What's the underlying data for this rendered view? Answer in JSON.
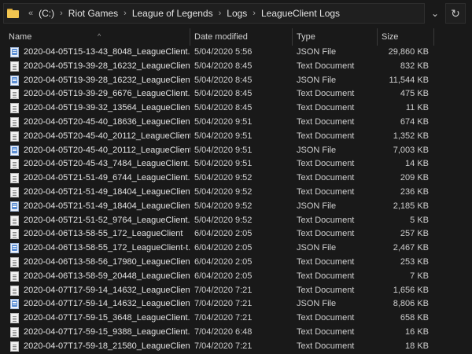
{
  "address": {
    "overflow": "«",
    "crumbs": [
      "(C:)",
      "Riot Games",
      "League of Legends",
      "Logs",
      "LeagueClient Logs"
    ],
    "separator": "›",
    "dropdown_glyph": "⌄",
    "refresh_glyph": "↻"
  },
  "columns": {
    "name": "Name",
    "date": "Date modified",
    "type": "Type",
    "size": "Size",
    "sort_glyph": "^"
  },
  "icons": {
    "folder": "folder-icon",
    "text": "text-document-icon",
    "json": "json-file-icon"
  },
  "files": [
    {
      "name": "2020-04-05T15-13-43_8048_LeagueClient...",
      "date": "5/04/2020 5:56",
      "type": "JSON File",
      "size": "29,860 KB",
      "icon": "json"
    },
    {
      "name": "2020-04-05T19-39-28_16232_LeagueClient",
      "date": "5/04/2020 8:45",
      "type": "Text Document",
      "size": "832 KB",
      "icon": "txt"
    },
    {
      "name": "2020-04-05T19-39-28_16232_LeagueClient",
      "date": "5/04/2020 8:45",
      "type": "JSON File",
      "size": "11,544 KB",
      "icon": "json"
    },
    {
      "name": "2020-04-05T19-39-29_6676_LeagueClient...",
      "date": "5/04/2020 8:45",
      "type": "Text Document",
      "size": "475 KB",
      "icon": "txt"
    },
    {
      "name": "2020-04-05T19-39-32_13564_LeagueClien...",
      "date": "5/04/2020 8:45",
      "type": "Text Document",
      "size": "11 KB",
      "icon": "txt"
    },
    {
      "name": "2020-04-05T20-45-40_18636_LeagueClien...",
      "date": "5/04/2020 9:51",
      "type": "Text Document",
      "size": "674 KB",
      "icon": "txt"
    },
    {
      "name": "2020-04-05T20-45-40_20112_LeagueClient",
      "date": "5/04/2020 9:51",
      "type": "Text Document",
      "size": "1,352 KB",
      "icon": "txt"
    },
    {
      "name": "2020-04-05T20-45-40_20112_LeagueClient",
      "date": "5/04/2020 9:51",
      "type": "JSON File",
      "size": "7,003 KB",
      "icon": "json"
    },
    {
      "name": "2020-04-05T20-45-43_7484_LeagueClient...",
      "date": "5/04/2020 9:51",
      "type": "Text Document",
      "size": "14 KB",
      "icon": "txt"
    },
    {
      "name": "2020-04-05T21-51-49_6744_LeagueClient...",
      "date": "5/04/2020 9:52",
      "type": "Text Document",
      "size": "209 KB",
      "icon": "txt"
    },
    {
      "name": "2020-04-05T21-51-49_18404_LeagueClient",
      "date": "5/04/2020 9:52",
      "type": "Text Document",
      "size": "236 KB",
      "icon": "txt"
    },
    {
      "name": "2020-04-05T21-51-49_18404_LeagueClient",
      "date": "5/04/2020 9:52",
      "type": "JSON File",
      "size": "2,185 KB",
      "icon": "json"
    },
    {
      "name": "2020-04-05T21-51-52_9764_LeagueClient...",
      "date": "5/04/2020 9:52",
      "type": "Text Document",
      "size": "5 KB",
      "icon": "txt"
    },
    {
      "name": "2020-04-06T13-58-55_172_LeagueClient",
      "date": "6/04/2020 2:05",
      "type": "Text Document",
      "size": "257 KB",
      "icon": "txt"
    },
    {
      "name": "2020-04-06T13-58-55_172_LeagueClient-t...",
      "date": "6/04/2020 2:05",
      "type": "JSON File",
      "size": "2,467 KB",
      "icon": "json"
    },
    {
      "name": "2020-04-06T13-58-56_17980_LeagueClien...",
      "date": "6/04/2020 2:05",
      "type": "Text Document",
      "size": "253 KB",
      "icon": "txt"
    },
    {
      "name": "2020-04-06T13-58-59_20448_LeagueClien...",
      "date": "6/04/2020 2:05",
      "type": "Text Document",
      "size": "7 KB",
      "icon": "txt"
    },
    {
      "name": "2020-04-07T17-59-14_14632_LeagueClient",
      "date": "7/04/2020 7:21",
      "type": "Text Document",
      "size": "1,656 KB",
      "icon": "txt"
    },
    {
      "name": "2020-04-07T17-59-14_14632_LeagueClient",
      "date": "7/04/2020 7:21",
      "type": "JSON File",
      "size": "8,806 KB",
      "icon": "json"
    },
    {
      "name": "2020-04-07T17-59-15_3648_LeagueClient...",
      "date": "7/04/2020 7:21",
      "type": "Text Document",
      "size": "658 KB",
      "icon": "txt"
    },
    {
      "name": "2020-04-07T17-59-15_9388_LeagueClient...",
      "date": "7/04/2020 6:48",
      "type": "Text Document",
      "size": "16 KB",
      "icon": "txt"
    },
    {
      "name": "2020-04-07T17-59-18_21580_LeagueClien...",
      "date": "7/04/2020 7:21",
      "type": "Text Document",
      "size": "18 KB",
      "icon": "txt"
    }
  ]
}
